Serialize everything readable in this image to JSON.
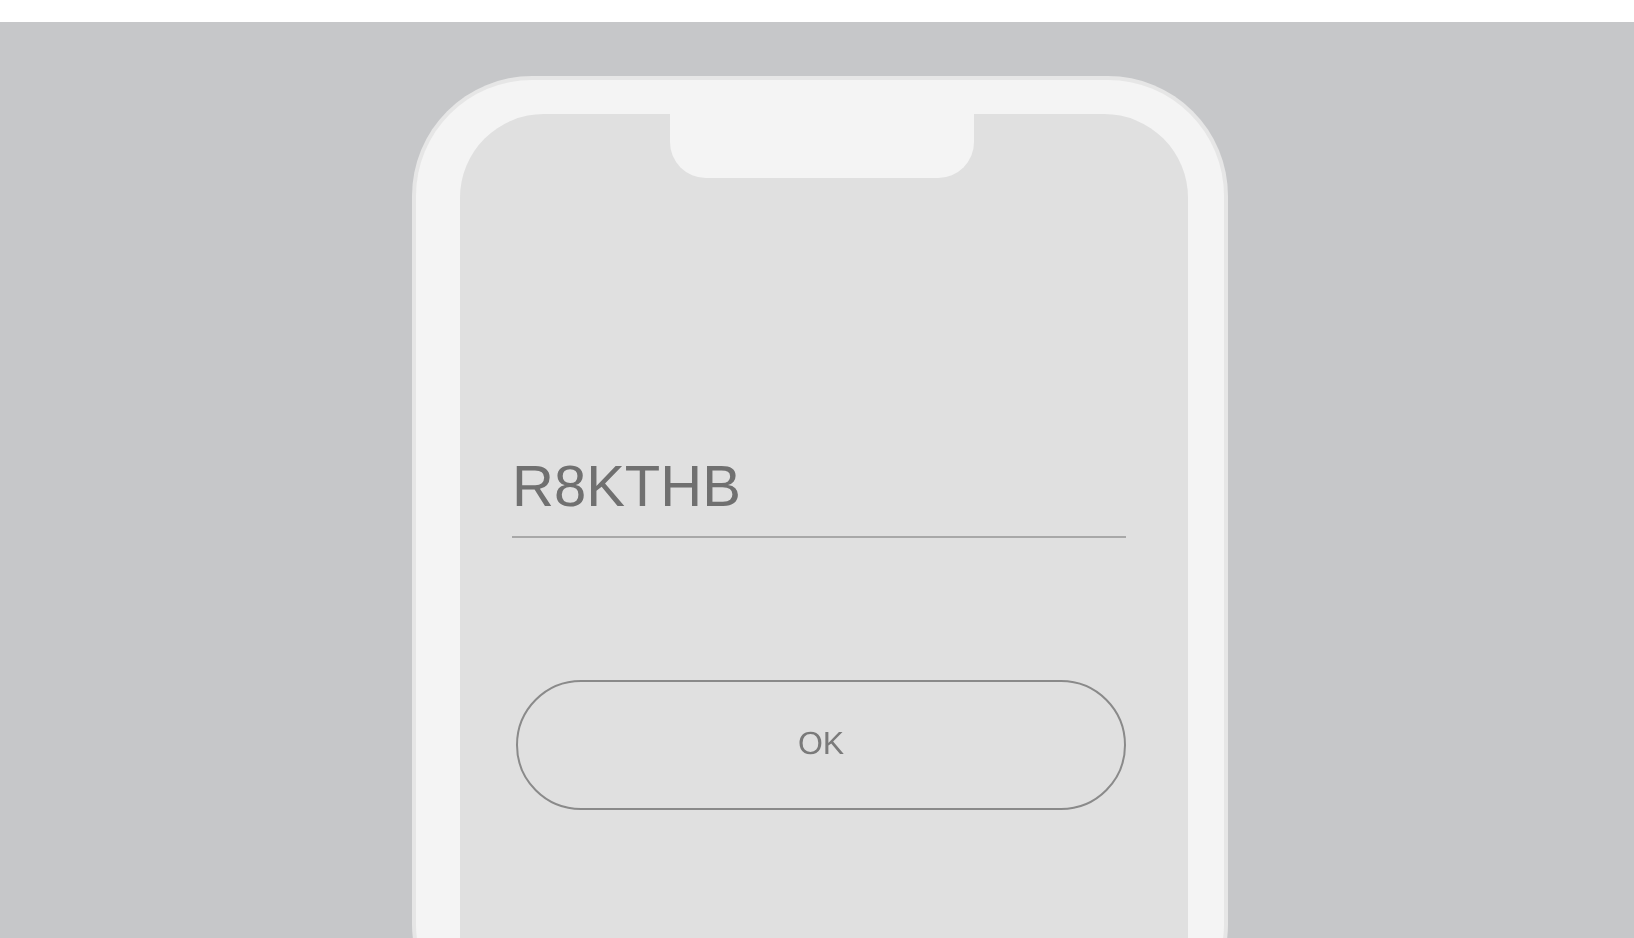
{
  "code_field": {
    "value": "R8KTHB"
  },
  "ok_button": {
    "label": "OK"
  }
}
